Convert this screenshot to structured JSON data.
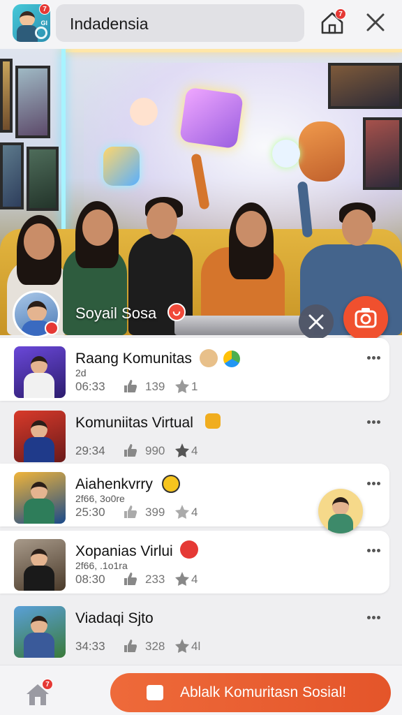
{
  "header": {
    "app_icon_badge": "7",
    "search_text": "Indadensia",
    "home_badge": "7"
  },
  "hero": {
    "host_name": "Soyail Sosa"
  },
  "list": {
    "items": [
      {
        "title": "Raang Komunitas",
        "subtitle": "2d",
        "time": "06:33",
        "likes": "139",
        "stars": "1",
        "emoji": "teddy-bear-icon",
        "accent": "#4caf50"
      },
      {
        "title": "Komuniitas Virtual",
        "subtitle": "",
        "time": "29:34",
        "likes": "990",
        "stars": "4",
        "emoji": "red-heart-icon",
        "accent": "#f0ad1f"
      },
      {
        "title": "Aiahenkvrry",
        "subtitle": "2f66, 3o0re",
        "time": "25:30",
        "likes": "399",
        "stars": "4",
        "emoji": "yellow-emoji-icon",
        "accent": "#f7c51e"
      },
      {
        "title": "Xopanias Virlui",
        "subtitle": "2f66, .1o1ra",
        "time": "08:30",
        "likes": "233",
        "stars": "4",
        "emoji": "red-face-icon",
        "accent": "#e53935"
      },
      {
        "title": "Viadaqi Sjto",
        "subtitle": "",
        "time": "34:33",
        "likes": "328",
        "stars": "4l",
        "emoji": "",
        "accent": ""
      }
    ]
  },
  "bottom": {
    "home_badge": "7",
    "cta_label": "Ablalk Komuritasn Sosial!"
  },
  "colors": {
    "accent": "#e9582d",
    "camera": "#f0502e",
    "badge": "#e53935"
  }
}
